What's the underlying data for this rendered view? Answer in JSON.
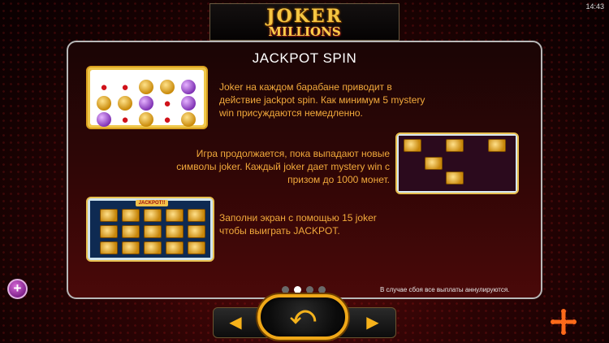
{
  "status": {
    "clock": "14:43"
  },
  "logo": {
    "top": "JOKER",
    "bottom": "MILLIONS"
  },
  "page": {
    "title": "JACKPOT SPIN",
    "paragraphs": [
      "Joker на каждом барабане приводит в действие jackpot spin. Как минимум 5 mystery win присуждаются немедленно.",
      "Игра продолжается, пока выпадают новые символы joker. Каждый joker дает mystery win с призом до 1000 монет.",
      "Заполни экран с помощью 15 joker чтобы выиграть JACKPOT."
    ],
    "thumb_banner": "JACKPOT!!",
    "disclaimer": "В случае сбоя все выплаты аннулируются."
  },
  "pager": {
    "count": 4,
    "active": 1
  },
  "controls": {
    "plus_label": "+",
    "prev_label": "◀",
    "next_label": "▶",
    "return_label": "⤺"
  },
  "colors": {
    "accent": "#f2a93b",
    "panel_border": "#b8b8b8",
    "button_gold": "#f0a818"
  },
  "icons": [
    "plus-icon",
    "arrow-left-icon",
    "arrow-right-icon",
    "return-icon",
    "yggdrasil-logo-icon"
  ]
}
